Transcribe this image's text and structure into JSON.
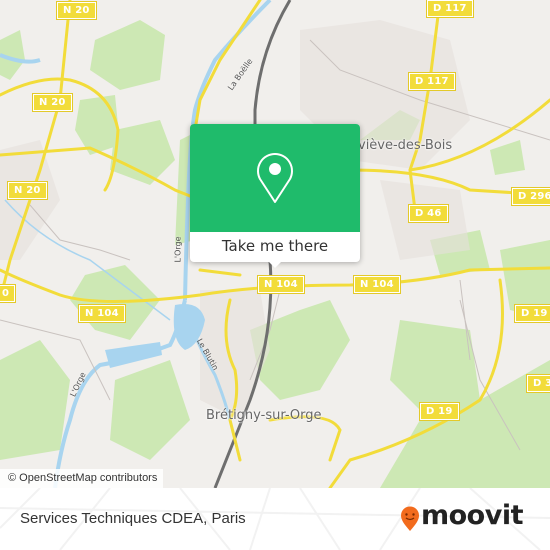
{
  "map": {
    "road_shields": [
      {
        "id": "n20-top",
        "label": "N 20"
      },
      {
        "id": "n20-mid",
        "label": "N 20"
      },
      {
        "id": "n20-low",
        "label": "N 20"
      },
      {
        "id": "n104-left",
        "label": "N 104"
      },
      {
        "id": "n104-center",
        "label": "N 104"
      },
      {
        "id": "n104-right",
        "label": "N 104"
      },
      {
        "id": "d117-top",
        "label": "D 117"
      },
      {
        "id": "d117-mid",
        "label": "D 117"
      },
      {
        "id": "d296",
        "label": "D 296"
      },
      {
        "id": "d46",
        "label": "D 46"
      },
      {
        "id": "d19-right",
        "label": "D 19"
      },
      {
        "id": "d19-bottom",
        "label": "D 19"
      },
      {
        "id": "d3",
        "label": "D 3"
      },
      {
        "id": "edge-left",
        "label": "0"
      }
    ],
    "places": [
      {
        "id": "sainte-genevieve",
        "label": "eviève-des-Bois"
      },
      {
        "id": "bretigny",
        "label": "Brétigny-sur-Orge"
      }
    ],
    "water_labels": [
      {
        "id": "la-boelle",
        "label": "La Boëlle"
      },
      {
        "id": "lorge-1",
        "label": "L'Orge"
      },
      {
        "id": "lorge-2",
        "label": "L'Orge"
      },
      {
        "id": "le-blutin",
        "label": "Le Blutin"
      }
    ],
    "attribution": "© OpenStreetMap contributors"
  },
  "popup": {
    "icon": "map-pin-icon",
    "button_label": "Take me there",
    "accent_color": "#1fbb6b"
  },
  "footer": {
    "title": "Services Techniques CDEA, Paris",
    "logo_text": "moovit",
    "logo_color": "#f26b1d"
  }
}
